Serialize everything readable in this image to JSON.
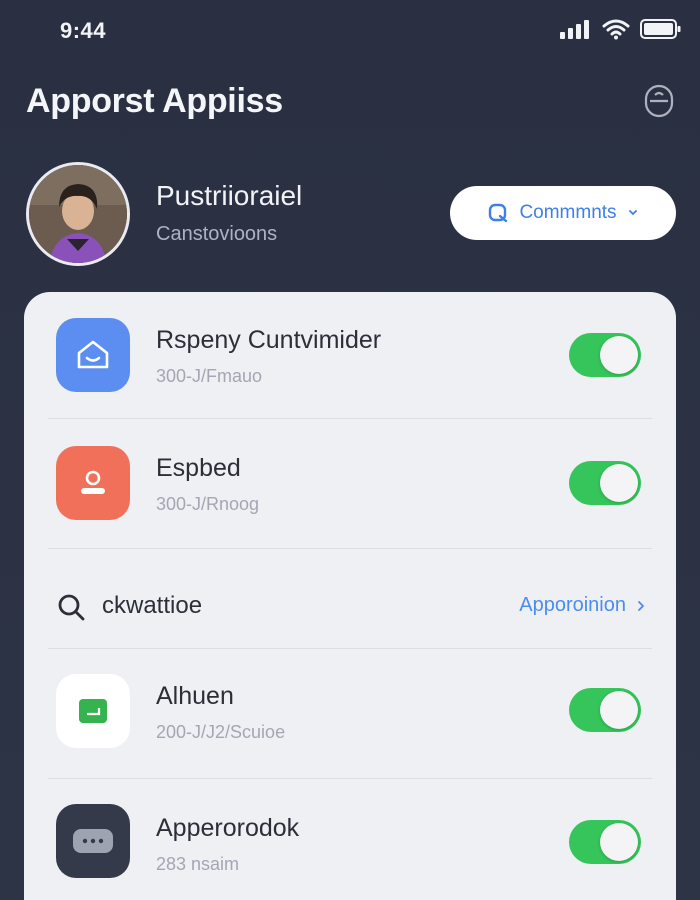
{
  "status_bar": {
    "time": "9:44"
  },
  "header": {
    "title": "Apporst Appiiss"
  },
  "profile": {
    "name": "Pustriioraiel",
    "subtitle": "Canstovioons",
    "action_label": "Commmnts"
  },
  "items": [
    {
      "title": "Rspeny Cuntvimider",
      "subtitle": "300-J/Fmauo",
      "icon": "home-icon",
      "icon_color": "#5b8ef0",
      "enabled": true
    },
    {
      "title": "Espbed",
      "subtitle": "300-J/Rnoog",
      "icon": "profile-icon",
      "icon_color": "#f0705a",
      "enabled": true
    }
  ],
  "search": {
    "label": "ckwattioe",
    "link_label": "Apporoinion"
  },
  "more_items": [
    {
      "title": "Alhuen",
      "subtitle": "200-J/J2/Scuioe",
      "icon": "screen-icon",
      "icon_color": "#ffffff",
      "enabled": true
    },
    {
      "title": "Apperorodok",
      "subtitle": "283 nsaim",
      "icon": "chat-icon",
      "icon_color": "#343a4a",
      "enabled": true
    }
  ],
  "colors": {
    "toggle_on": "#35c55a",
    "accent": "#4b8ded",
    "background": "#2b3142"
  }
}
